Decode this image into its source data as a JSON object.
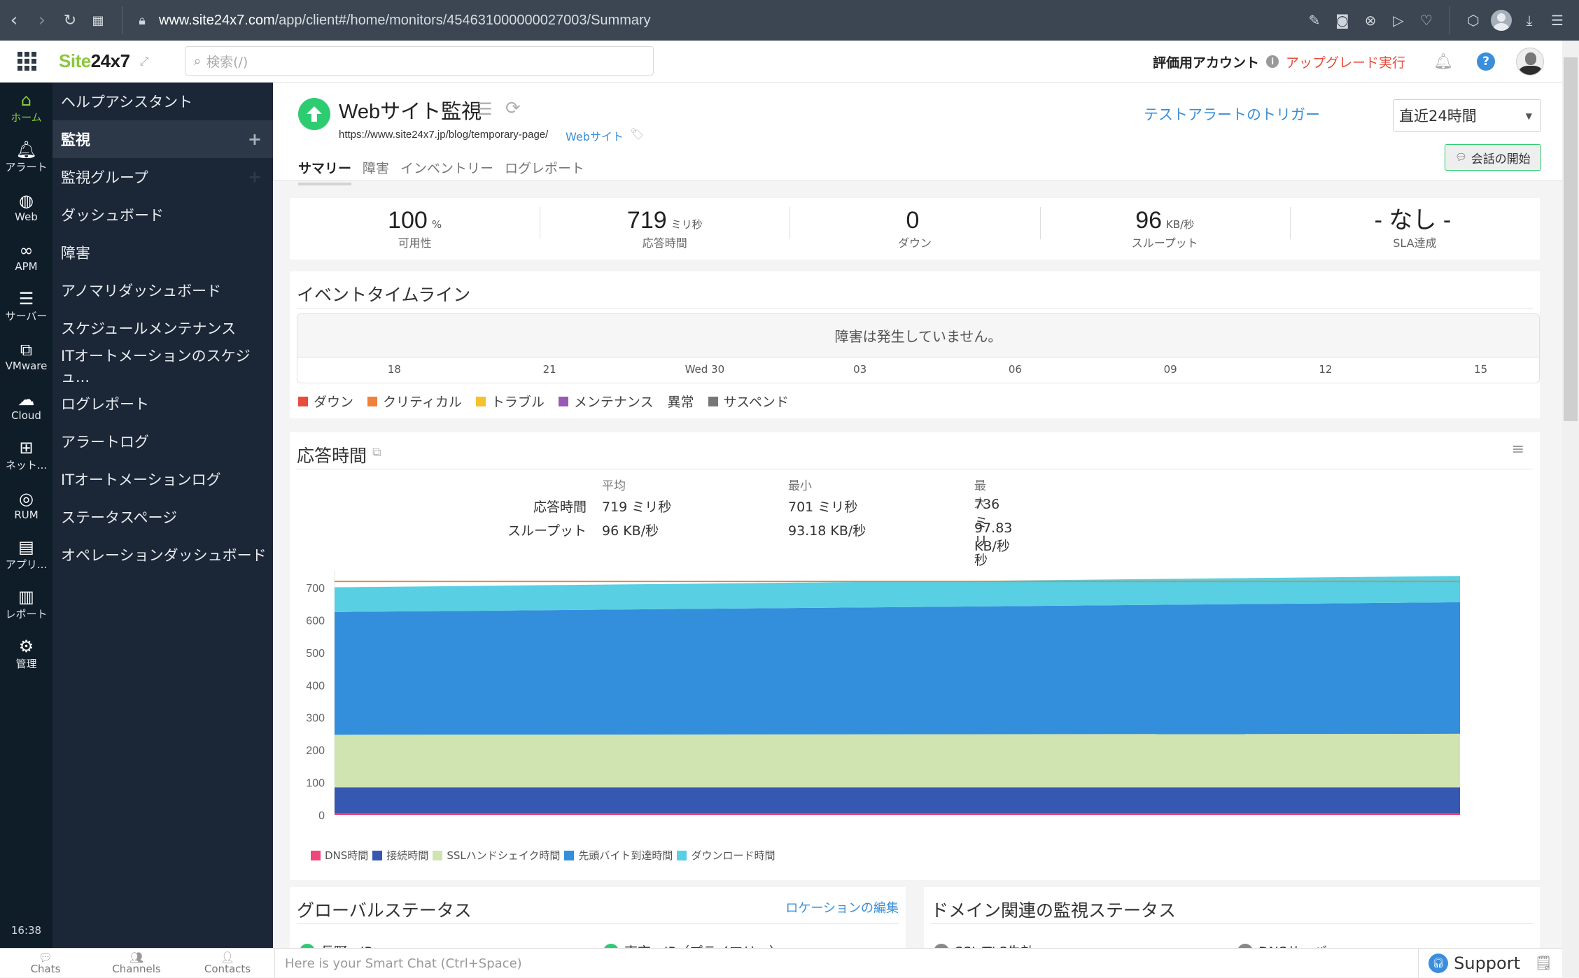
{
  "browser": {
    "url_host": "www.site24x7.com",
    "url_path": "/app/client#/home/monitors/454631000000027003/Summary",
    "nav_icons": [
      "back-icon",
      "forward-icon",
      "reload-icon",
      "tabs-grid-icon",
      "lock-icon"
    ],
    "toolbar_icons": [
      "edit-icon",
      "camera-icon",
      "shield-x-icon",
      "send-icon",
      "heart-icon",
      "cube-icon",
      "profile-icon",
      "download-icon",
      "settings-sliders-icon"
    ]
  },
  "header": {
    "logo_green": "Site",
    "logo_dark": "24x7",
    "search_placeholder": "検索(/)",
    "account_label": "評価用アカウント",
    "upgrade_link": "アップグレード実行",
    "help_label": "?"
  },
  "iconbar": {
    "items": [
      {
        "label": "ホーム",
        "icon": "home-icon",
        "active": true
      },
      {
        "label": "アラート",
        "icon": "bell-icon"
      },
      {
        "label": "Web",
        "icon": "globe-icon"
      },
      {
        "label": "APM",
        "icon": "binoculars-icon"
      },
      {
        "label": "サーバー",
        "icon": "server-icon"
      },
      {
        "label": "VMware",
        "icon": "vmware-icon"
      },
      {
        "label": "Cloud",
        "icon": "cloud-icon"
      },
      {
        "label": "ネット...",
        "icon": "network-icon"
      },
      {
        "label": "RUM",
        "icon": "rum-globe-icon"
      },
      {
        "label": "アプリ...",
        "icon": "app-log-icon"
      },
      {
        "label": "レポート",
        "icon": "report-icon"
      },
      {
        "label": "管理",
        "icon": "gear-icon"
      }
    ],
    "clock": "16:38"
  },
  "menu": {
    "items": [
      {
        "label": "ヘルプアシスタント"
      },
      {
        "label": "監視",
        "active": true,
        "plus": true
      },
      {
        "label": "監視グループ",
        "plus_dim": true
      },
      {
        "label": "ダッシュボード"
      },
      {
        "label": "障害"
      },
      {
        "label": "アノマリダッシュボード"
      },
      {
        "label": "スケジュールメンテナンス"
      },
      {
        "label": "ITオートメーションのスケジュ..."
      },
      {
        "label": "ログレポート"
      },
      {
        "label": "アラートログ"
      },
      {
        "label": "ITオートメーションログ"
      },
      {
        "label": "ステータスページ"
      },
      {
        "label": "オペレーションダッシュボード"
      }
    ]
  },
  "monitor": {
    "title": "Webサイト監視",
    "url": "https://www.site24x7.jp/blog/temporary-page/",
    "type": "Webサイト",
    "status": "up",
    "tabs": [
      "サマリー",
      "障害",
      "インベントリー",
      "ログレポート"
    ],
    "active_tab": 0,
    "trigger_link": "テストアラートのトリガー",
    "time_range": "直近24時間",
    "conversation_button": "会話の開始"
  },
  "kpis": [
    {
      "value": "100",
      "unit": "%",
      "label": "可用性"
    },
    {
      "value": "719",
      "unit": "ミリ秒",
      "label": "応答時間"
    },
    {
      "value": "0",
      "unit": "",
      "label": "ダウン"
    },
    {
      "value": "96",
      "unit": "KB/秒",
      "label": "スループット"
    },
    {
      "value": "- なし -",
      "unit": "",
      "label": "SLA達成"
    }
  ],
  "timeline": {
    "title": "イベントタイムライン",
    "empty_message": "障害は発生していません。",
    "ticks": [
      "18",
      "21",
      "Wed 30",
      "03",
      "06",
      "09",
      "12",
      "15"
    ],
    "legend": [
      {
        "label": "ダウン",
        "color": "#e74c3c"
      },
      {
        "label": "クリティカル",
        "color": "#f0803c"
      },
      {
        "label": "トラブル",
        "color": "#f5c12e"
      },
      {
        "label": "メンテナンス",
        "color": "#9b59b6"
      },
      {
        "label": "異常",
        "color": null
      },
      {
        "label": "サスペンド",
        "color": "#777777"
      }
    ]
  },
  "response": {
    "title": "応答時間",
    "headers": [
      "平均",
      "最小",
      "最大"
    ],
    "rows": [
      {
        "label": "応答時間",
        "values": [
          "719 ミリ秒",
          "701 ミリ秒",
          "736 ミリ秒"
        ]
      },
      {
        "label": "スループット",
        "values": [
          "96 KB/秒",
          "93.18 KB/秒",
          "97.83 KB/秒"
        ]
      }
    ]
  },
  "chart_data": {
    "type": "area",
    "stacked": true,
    "title": "応答時間",
    "xlabel": "",
    "ylabel": "",
    "ylim": [
      0,
      700
    ],
    "yticks": [
      0,
      100,
      200,
      300,
      400,
      500,
      600,
      700
    ],
    "x": [
      0,
      1
    ],
    "average_line": 719,
    "series": [
      {
        "name": "DNS時間",
        "color": "#f0457a",
        "values": [
          5,
          5
        ]
      },
      {
        "name": "接続時間",
        "color": "#3658b0",
        "values": [
          80,
          80
        ]
      },
      {
        "name": "SSLハンドシェイク時間",
        "color": "#cfe4b1",
        "values": [
          162,
          165
        ]
      },
      {
        "name": "先頭バイト到達時間",
        "color": "#338fdc",
        "values": [
          378,
          405
        ]
      },
      {
        "name": "ダウンロード時間",
        "color": "#58cfe2",
        "values": [
          76,
          81
        ]
      }
    ],
    "legend_position": "bottom-left",
    "grid": false
  },
  "global_status": {
    "title": "グローバルステータス",
    "edit_link": "ロケーションの編集",
    "locations": [
      "長野 - JP",
      "東京 - JP（プライマリー）"
    ]
  },
  "domain_status": {
    "title": "ドメイン関連の監視ステータス",
    "items": [
      "SSL/TLS失効",
      "DNSサーバ"
    ]
  },
  "bottombar": {
    "tabs": [
      "Chats",
      "Channels",
      "Contacts"
    ],
    "smartchat_placeholder": "Here is your Smart Chat (Ctrl+Space)",
    "support": "Support"
  }
}
